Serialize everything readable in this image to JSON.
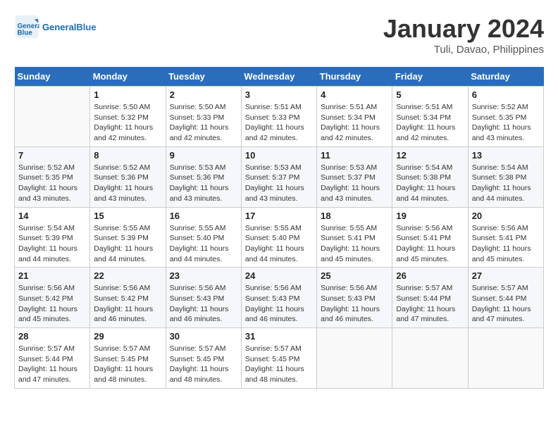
{
  "header": {
    "logo_general": "General",
    "logo_blue": "Blue",
    "month_title": "January 2024",
    "location": "Tuli, Davao, Philippines"
  },
  "weekdays": [
    "Sunday",
    "Monday",
    "Tuesday",
    "Wednesday",
    "Thursday",
    "Friday",
    "Saturday"
  ],
  "weeks": [
    [
      {
        "day": "",
        "sunrise": "",
        "sunset": "",
        "daylight": ""
      },
      {
        "day": "1",
        "sunrise": "Sunrise: 5:50 AM",
        "sunset": "Sunset: 5:32 PM",
        "daylight": "Daylight: 11 hours and 42 minutes."
      },
      {
        "day": "2",
        "sunrise": "Sunrise: 5:50 AM",
        "sunset": "Sunset: 5:33 PM",
        "daylight": "Daylight: 11 hours and 42 minutes."
      },
      {
        "day": "3",
        "sunrise": "Sunrise: 5:51 AM",
        "sunset": "Sunset: 5:33 PM",
        "daylight": "Daylight: 11 hours and 42 minutes."
      },
      {
        "day": "4",
        "sunrise": "Sunrise: 5:51 AM",
        "sunset": "Sunset: 5:34 PM",
        "daylight": "Daylight: 11 hours and 42 minutes."
      },
      {
        "day": "5",
        "sunrise": "Sunrise: 5:51 AM",
        "sunset": "Sunset: 5:34 PM",
        "daylight": "Daylight: 11 hours and 42 minutes."
      },
      {
        "day": "6",
        "sunrise": "Sunrise: 5:52 AM",
        "sunset": "Sunset: 5:35 PM",
        "daylight": "Daylight: 11 hours and 43 minutes."
      }
    ],
    [
      {
        "day": "7",
        "sunrise": "Sunrise: 5:52 AM",
        "sunset": "Sunset: 5:35 PM",
        "daylight": "Daylight: 11 hours and 43 minutes."
      },
      {
        "day": "8",
        "sunrise": "Sunrise: 5:52 AM",
        "sunset": "Sunset: 5:36 PM",
        "daylight": "Daylight: 11 hours and 43 minutes."
      },
      {
        "day": "9",
        "sunrise": "Sunrise: 5:53 AM",
        "sunset": "Sunset: 5:36 PM",
        "daylight": "Daylight: 11 hours and 43 minutes."
      },
      {
        "day": "10",
        "sunrise": "Sunrise: 5:53 AM",
        "sunset": "Sunset: 5:37 PM",
        "daylight": "Daylight: 11 hours and 43 minutes."
      },
      {
        "day": "11",
        "sunrise": "Sunrise: 5:53 AM",
        "sunset": "Sunset: 5:37 PM",
        "daylight": "Daylight: 11 hours and 43 minutes."
      },
      {
        "day": "12",
        "sunrise": "Sunrise: 5:54 AM",
        "sunset": "Sunset: 5:38 PM",
        "daylight": "Daylight: 11 hours and 44 minutes."
      },
      {
        "day": "13",
        "sunrise": "Sunrise: 5:54 AM",
        "sunset": "Sunset: 5:38 PM",
        "daylight": "Daylight: 11 hours and 44 minutes."
      }
    ],
    [
      {
        "day": "14",
        "sunrise": "Sunrise: 5:54 AM",
        "sunset": "Sunset: 5:39 PM",
        "daylight": "Daylight: 11 hours and 44 minutes."
      },
      {
        "day": "15",
        "sunrise": "Sunrise: 5:55 AM",
        "sunset": "Sunset: 5:39 PM",
        "daylight": "Daylight: 11 hours and 44 minutes."
      },
      {
        "day": "16",
        "sunrise": "Sunrise: 5:55 AM",
        "sunset": "Sunset: 5:40 PM",
        "daylight": "Daylight: 11 hours and 44 minutes."
      },
      {
        "day": "17",
        "sunrise": "Sunrise: 5:55 AM",
        "sunset": "Sunset: 5:40 PM",
        "daylight": "Daylight: 11 hours and 44 minutes."
      },
      {
        "day": "18",
        "sunrise": "Sunrise: 5:55 AM",
        "sunset": "Sunset: 5:41 PM",
        "daylight": "Daylight: 11 hours and 45 minutes."
      },
      {
        "day": "19",
        "sunrise": "Sunrise: 5:56 AM",
        "sunset": "Sunset: 5:41 PM",
        "daylight": "Daylight: 11 hours and 45 minutes."
      },
      {
        "day": "20",
        "sunrise": "Sunrise: 5:56 AM",
        "sunset": "Sunset: 5:41 PM",
        "daylight": "Daylight: 11 hours and 45 minutes."
      }
    ],
    [
      {
        "day": "21",
        "sunrise": "Sunrise: 5:56 AM",
        "sunset": "Sunset: 5:42 PM",
        "daylight": "Daylight: 11 hours and 45 minutes."
      },
      {
        "day": "22",
        "sunrise": "Sunrise: 5:56 AM",
        "sunset": "Sunset: 5:42 PM",
        "daylight": "Daylight: 11 hours and 46 minutes."
      },
      {
        "day": "23",
        "sunrise": "Sunrise: 5:56 AM",
        "sunset": "Sunset: 5:43 PM",
        "daylight": "Daylight: 11 hours and 46 minutes."
      },
      {
        "day": "24",
        "sunrise": "Sunrise: 5:56 AM",
        "sunset": "Sunset: 5:43 PM",
        "daylight": "Daylight: 11 hours and 46 minutes."
      },
      {
        "day": "25",
        "sunrise": "Sunrise: 5:56 AM",
        "sunset": "Sunset: 5:43 PM",
        "daylight": "Daylight: 11 hours and 46 minutes."
      },
      {
        "day": "26",
        "sunrise": "Sunrise: 5:57 AM",
        "sunset": "Sunset: 5:44 PM",
        "daylight": "Daylight: 11 hours and 47 minutes."
      },
      {
        "day": "27",
        "sunrise": "Sunrise: 5:57 AM",
        "sunset": "Sunset: 5:44 PM",
        "daylight": "Daylight: 11 hours and 47 minutes."
      }
    ],
    [
      {
        "day": "28",
        "sunrise": "Sunrise: 5:57 AM",
        "sunset": "Sunset: 5:44 PM",
        "daylight": "Daylight: 11 hours and 47 minutes."
      },
      {
        "day": "29",
        "sunrise": "Sunrise: 5:57 AM",
        "sunset": "Sunset: 5:45 PM",
        "daylight": "Daylight: 11 hours and 48 minutes."
      },
      {
        "day": "30",
        "sunrise": "Sunrise: 5:57 AM",
        "sunset": "Sunset: 5:45 PM",
        "daylight": "Daylight: 11 hours and 48 minutes."
      },
      {
        "day": "31",
        "sunrise": "Sunrise: 5:57 AM",
        "sunset": "Sunset: 5:45 PM",
        "daylight": "Daylight: 11 hours and 48 minutes."
      },
      {
        "day": "",
        "sunrise": "",
        "sunset": "",
        "daylight": ""
      },
      {
        "day": "",
        "sunrise": "",
        "sunset": "",
        "daylight": ""
      },
      {
        "day": "",
        "sunrise": "",
        "sunset": "",
        "daylight": ""
      }
    ]
  ]
}
